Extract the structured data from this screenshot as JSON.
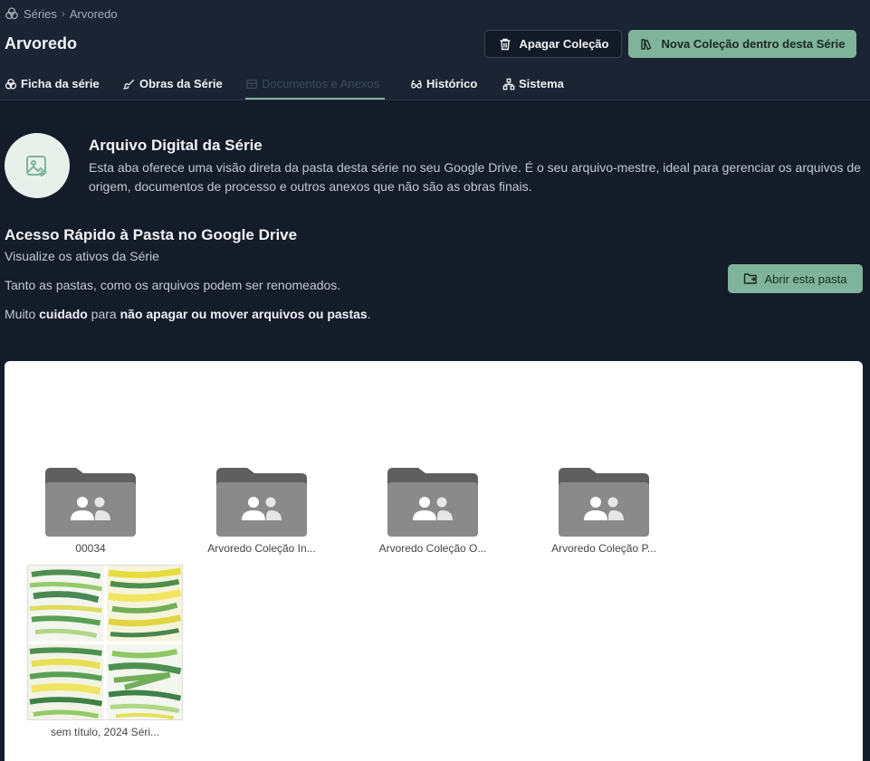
{
  "breadcrumb": {
    "root": "Séries",
    "separator": "›",
    "current": "Arvoredo"
  },
  "header": {
    "title": "Arvoredo",
    "delete_label": "Apagar Coleção",
    "new_label": "Nova Coleção dentro desta Série"
  },
  "tabs": [
    {
      "label": "Ficha da série",
      "icon": "venn-circles-icon"
    },
    {
      "label": "Obras da Série",
      "icon": "brush-icon"
    },
    {
      "label": "Documentos e Anexos",
      "icon": "archive-icon",
      "active": true
    },
    {
      "label": "Histórico",
      "icon": "glasses-icon"
    },
    {
      "label": "Sistema",
      "icon": "network-icon"
    }
  ],
  "intro": {
    "title": "Arquivo Digital da Série",
    "description": "Esta aba oferece uma visão direta da pasta desta série no seu Google Drive. É o seu arquivo-mestre, ideal para gerenciar os arquivos de origem, documentos de processo e outros anexos que não são as obras finais."
  },
  "drive_section": {
    "title": "Acesso Rápido à Pasta no Google Drive",
    "subtitle": "Visualize os ativos da Série",
    "rename_note": "Tanto as pastas, como os arquivos podem ser renomeados.",
    "caution_prefix": "Muito ",
    "caution_bold_1": "cuidado",
    "caution_middle": " para ",
    "caution_bold_2": "não apagar ou mover arquivos ou pastas",
    "caution_suffix": ".",
    "open_folder_label": "Abrir esta pasta"
  },
  "drive_items": {
    "folders": [
      {
        "label": "00034"
      },
      {
        "label": "Arvoredo Coleção In..."
      },
      {
        "label": "Arvoredo Coleção O..."
      },
      {
        "label": "Arvoredo Coleção P..."
      }
    ],
    "files": [
      {
        "label": "sem título, 2024 Séri..."
      }
    ]
  },
  "colors": {
    "background": "#141b29",
    "topbar": "#1b2433",
    "accent": "#7fb39b",
    "folder": "#8a8a8a"
  }
}
